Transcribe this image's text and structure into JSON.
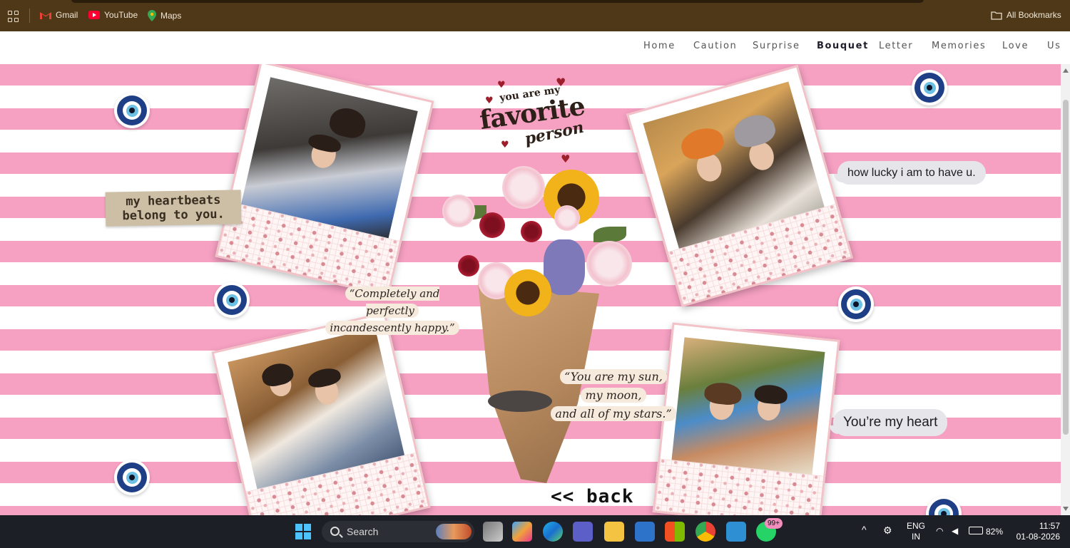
{
  "bookmarks": {
    "items": [
      {
        "label": "Gmail",
        "icon": "gmail-icon"
      },
      {
        "label": "YouTube",
        "icon": "youtube-icon"
      },
      {
        "label": "Maps",
        "icon": "maps-icon"
      }
    ],
    "all_label": "All Bookmarks"
  },
  "nav": {
    "links": [
      "Home",
      "Caution",
      "Surprise",
      "Bouquet",
      "Letter",
      "Memories",
      "Love",
      "Us"
    ],
    "active": "Bouquet"
  },
  "page": {
    "note": "my heartbeats\nbelong to you.",
    "quote1": [
      "“Completely and perfectly",
      "incandescently happy.”"
    ],
    "quote2": [
      "“You are my sun,",
      "my moon,",
      "and all of my stars.”"
    ],
    "bubble1": "how lucky i am to have u.",
    "bubble2": "You’re my heart",
    "fav_small": "you are my",
    "fav_big": "favorite",
    "fav_script": "person",
    "back": "<< back"
  },
  "taskbar": {
    "search_label": "Search",
    "badge": "99+",
    "lang_line1": "ENG",
    "lang_line2": "IN",
    "battery": "82%",
    "time": "11:57",
    "date": "01-08-2026"
  },
  "colors": {
    "stripe_pink": "#f6a0c2",
    "browser_bar": "#4e3818",
    "taskbar": "#1d1f26"
  }
}
